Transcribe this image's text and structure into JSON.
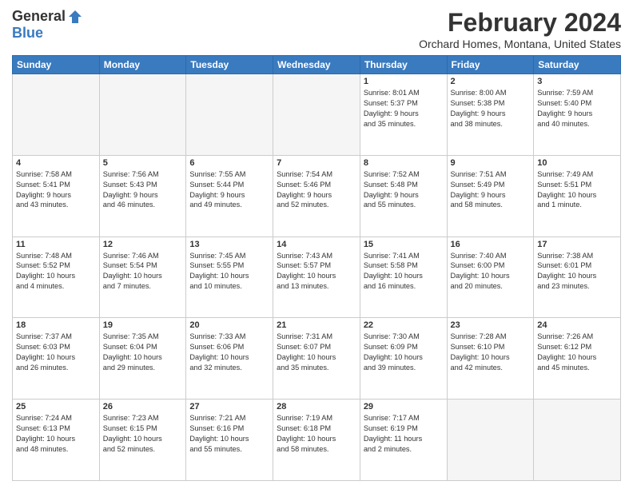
{
  "header": {
    "logo_general": "General",
    "logo_blue": "Blue",
    "month_title": "February 2024",
    "location": "Orchard Homes, Montana, United States"
  },
  "weekdays": [
    "Sunday",
    "Monday",
    "Tuesday",
    "Wednesday",
    "Thursday",
    "Friday",
    "Saturday"
  ],
  "weeks": [
    [
      {
        "day": "",
        "info": ""
      },
      {
        "day": "",
        "info": ""
      },
      {
        "day": "",
        "info": ""
      },
      {
        "day": "",
        "info": ""
      },
      {
        "day": "1",
        "info": "Sunrise: 8:01 AM\nSunset: 5:37 PM\nDaylight: 9 hours\nand 35 minutes."
      },
      {
        "day": "2",
        "info": "Sunrise: 8:00 AM\nSunset: 5:38 PM\nDaylight: 9 hours\nand 38 minutes."
      },
      {
        "day": "3",
        "info": "Sunrise: 7:59 AM\nSunset: 5:40 PM\nDaylight: 9 hours\nand 40 minutes."
      }
    ],
    [
      {
        "day": "4",
        "info": "Sunrise: 7:58 AM\nSunset: 5:41 PM\nDaylight: 9 hours\nand 43 minutes."
      },
      {
        "day": "5",
        "info": "Sunrise: 7:56 AM\nSunset: 5:43 PM\nDaylight: 9 hours\nand 46 minutes."
      },
      {
        "day": "6",
        "info": "Sunrise: 7:55 AM\nSunset: 5:44 PM\nDaylight: 9 hours\nand 49 minutes."
      },
      {
        "day": "7",
        "info": "Sunrise: 7:54 AM\nSunset: 5:46 PM\nDaylight: 9 hours\nand 52 minutes."
      },
      {
        "day": "8",
        "info": "Sunrise: 7:52 AM\nSunset: 5:48 PM\nDaylight: 9 hours\nand 55 minutes."
      },
      {
        "day": "9",
        "info": "Sunrise: 7:51 AM\nSunset: 5:49 PM\nDaylight: 9 hours\nand 58 minutes."
      },
      {
        "day": "10",
        "info": "Sunrise: 7:49 AM\nSunset: 5:51 PM\nDaylight: 10 hours\nand 1 minute."
      }
    ],
    [
      {
        "day": "11",
        "info": "Sunrise: 7:48 AM\nSunset: 5:52 PM\nDaylight: 10 hours\nand 4 minutes."
      },
      {
        "day": "12",
        "info": "Sunrise: 7:46 AM\nSunset: 5:54 PM\nDaylight: 10 hours\nand 7 minutes."
      },
      {
        "day": "13",
        "info": "Sunrise: 7:45 AM\nSunset: 5:55 PM\nDaylight: 10 hours\nand 10 minutes."
      },
      {
        "day": "14",
        "info": "Sunrise: 7:43 AM\nSunset: 5:57 PM\nDaylight: 10 hours\nand 13 minutes."
      },
      {
        "day": "15",
        "info": "Sunrise: 7:41 AM\nSunset: 5:58 PM\nDaylight: 10 hours\nand 16 minutes."
      },
      {
        "day": "16",
        "info": "Sunrise: 7:40 AM\nSunset: 6:00 PM\nDaylight: 10 hours\nand 20 minutes."
      },
      {
        "day": "17",
        "info": "Sunrise: 7:38 AM\nSunset: 6:01 PM\nDaylight: 10 hours\nand 23 minutes."
      }
    ],
    [
      {
        "day": "18",
        "info": "Sunrise: 7:37 AM\nSunset: 6:03 PM\nDaylight: 10 hours\nand 26 minutes."
      },
      {
        "day": "19",
        "info": "Sunrise: 7:35 AM\nSunset: 6:04 PM\nDaylight: 10 hours\nand 29 minutes."
      },
      {
        "day": "20",
        "info": "Sunrise: 7:33 AM\nSunset: 6:06 PM\nDaylight: 10 hours\nand 32 minutes."
      },
      {
        "day": "21",
        "info": "Sunrise: 7:31 AM\nSunset: 6:07 PM\nDaylight: 10 hours\nand 35 minutes."
      },
      {
        "day": "22",
        "info": "Sunrise: 7:30 AM\nSunset: 6:09 PM\nDaylight: 10 hours\nand 39 minutes."
      },
      {
        "day": "23",
        "info": "Sunrise: 7:28 AM\nSunset: 6:10 PM\nDaylight: 10 hours\nand 42 minutes."
      },
      {
        "day": "24",
        "info": "Sunrise: 7:26 AM\nSunset: 6:12 PM\nDaylight: 10 hours\nand 45 minutes."
      }
    ],
    [
      {
        "day": "25",
        "info": "Sunrise: 7:24 AM\nSunset: 6:13 PM\nDaylight: 10 hours\nand 48 minutes."
      },
      {
        "day": "26",
        "info": "Sunrise: 7:23 AM\nSunset: 6:15 PM\nDaylight: 10 hours\nand 52 minutes."
      },
      {
        "day": "27",
        "info": "Sunrise: 7:21 AM\nSunset: 6:16 PM\nDaylight: 10 hours\nand 55 minutes."
      },
      {
        "day": "28",
        "info": "Sunrise: 7:19 AM\nSunset: 6:18 PM\nDaylight: 10 hours\nand 58 minutes."
      },
      {
        "day": "29",
        "info": "Sunrise: 7:17 AM\nSunset: 6:19 PM\nDaylight: 11 hours\nand 2 minutes."
      },
      {
        "day": "",
        "info": ""
      },
      {
        "day": "",
        "info": ""
      }
    ]
  ]
}
